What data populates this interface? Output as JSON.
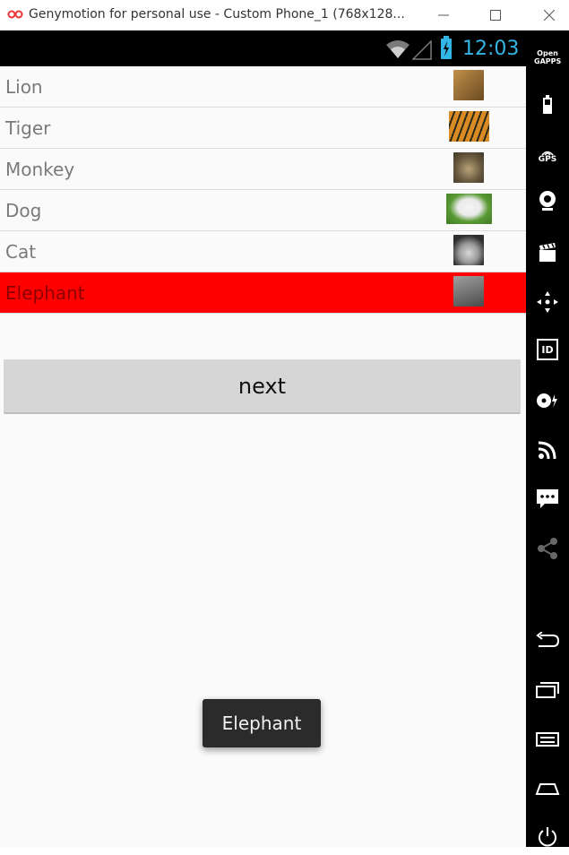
{
  "window": {
    "title": "Genymotion for personal use - Custom Phone_1 (768x128..."
  },
  "statusbar": {
    "time": "12:03"
  },
  "list": {
    "items": [
      {
        "label": "Lion",
        "selected": false,
        "thumb_colors": [
          "#a97a3a",
          "#6b4a1f"
        ]
      },
      {
        "label": "Tiger",
        "selected": false,
        "thumb_colors": [
          "#d07b1c",
          "#3f5a1e"
        ]
      },
      {
        "label": "Monkey",
        "selected": false,
        "thumb_colors": [
          "#8a7a5f",
          "#4e4435"
        ]
      },
      {
        "label": "Dog",
        "selected": false,
        "thumb_colors": [
          "#eaeaea",
          "#3f8a2a"
        ]
      },
      {
        "label": "Cat",
        "selected": false,
        "thumb_colors": [
          "#bfbfbf",
          "#2e2e2e"
        ]
      },
      {
        "label": "Elephant",
        "selected": true,
        "thumb_colors": [
          "#8c8c8c",
          "#3a3a3a"
        ]
      }
    ],
    "selected_color": "#ff0000"
  },
  "button": {
    "next_label": "next"
  },
  "toast": {
    "text": "Elephant"
  },
  "sidebar": {
    "opengapps_label": "Open GAPPS",
    "gps_label": "GPS",
    "id_label": "ID"
  },
  "colors": {
    "accent": "#33b5e5"
  }
}
